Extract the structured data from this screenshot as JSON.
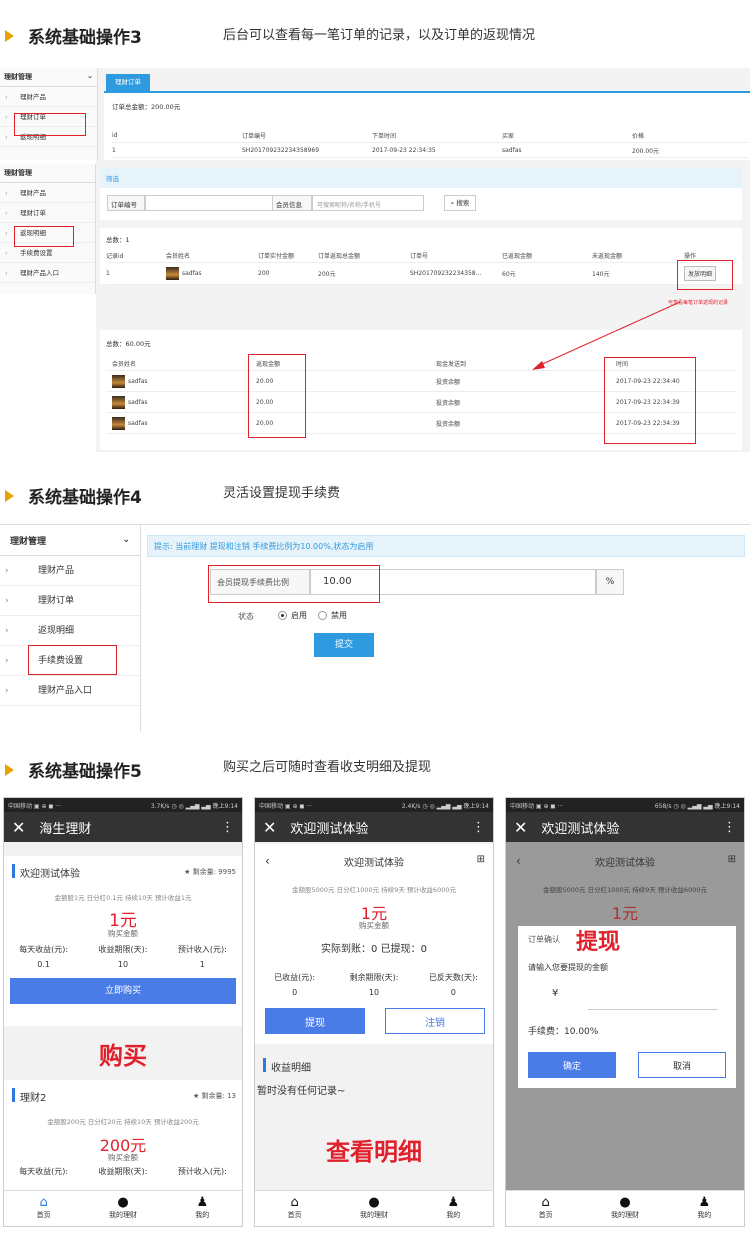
{
  "sec3": {
    "title": "系统基础操作3",
    "desc": "后台可以查看每一笔订单的记录，以及订单的返现情况"
  },
  "sec4": {
    "title": "系统基础操作4",
    "desc": "灵活设置提现手续费"
  },
  "sec5": {
    "title": "系统基础操作5",
    "desc": "购买之后可随时查看收支明细及提现"
  },
  "shot1": {
    "side_header": "理财管理",
    "side_items": [
      "理财产品",
      "理财订单",
      "返现明细"
    ],
    "tab": "理财订单",
    "summary": "订单总金额：200.00元",
    "cols": [
      "id",
      "订单编号",
      "下单时间",
      "买家",
      "价格"
    ],
    "row": [
      "1",
      "SH201709232234358969",
      "2017-09-23 22:34:35",
      "sadfas",
      "200.00元"
    ]
  },
  "shot2": {
    "side_header": "理财管理",
    "side_items": [
      "理财产品",
      "理财订单",
      "返现明细",
      "手续费设置",
      "理财产品入口"
    ],
    "filter_title": "筛选",
    "order_no_label": "订单编号",
    "member_label": "会员信息",
    "member_placeholder": "可搜索昵称/名称/手机号",
    "search_btn": "搜索",
    "total": "总数：1",
    "cols": [
      "记录id",
      "会员姓名",
      "订单实付金额",
      "订单返现总金额",
      "订单号",
      "已返现金额",
      "未返现金额",
      "操作"
    ],
    "row": [
      "1",
      "sadfas",
      "200",
      "200元",
      "SH201709232234358...",
      "60元",
      "140元",
      "发放明细"
    ],
    "note": "可查看每笔订单返现的记录",
    "total2": "总数：60.00元",
    "cols2": [
      "会员姓名",
      "返现金额",
      "现金发送到",
      "时间"
    ],
    "rows2": [
      [
        "sadfas",
        "20.00",
        "投资余额",
        "2017-09-23 22:34:40"
      ],
      [
        "sadfas",
        "20.00",
        "投资余额",
        "2017-09-23 22:34:39"
      ],
      [
        "sadfas",
        "20.00",
        "投资余额",
        "2017-09-23 22:34:39"
      ]
    ]
  },
  "shot3": {
    "side_header": "理财管理",
    "side_items": [
      "理财产品",
      "理财订单",
      "返现明细",
      "手续费设置",
      "理财产品入口"
    ],
    "tip": "提示: 当前理财 提现和注销 手续费比例为10.00%,状态为启用",
    "fee_label": "会员提现手续费比例",
    "fee_value": "10.00",
    "fee_unit": "%",
    "status_label": "状态",
    "status_on": "启用",
    "status_off": "禁用",
    "submit": "提交"
  },
  "phone1": {
    "status_l": "中国移动 ▣ ⊕ ◼ ···",
    "status_r": "3.7K/s ◷ ◎ ▂▄▆ ▃▅ 晚上9:14",
    "title": "海生理财",
    "p1_name": "欢迎测试体验",
    "p1_remain": "剩余量: 9995",
    "p1_sub": "金额股1元 日分红0.1元 持续10天 预计收益1元",
    "p1_price": "1元",
    "p1_price_label": "购买金额",
    "p1_stats_labels": [
      "每天收益(元):",
      "收益期限(天):",
      "预计收入(元):"
    ],
    "p1_stats_values": [
      "0.1",
      "10",
      "1"
    ],
    "buy_btn": "立即购买",
    "big": "购买",
    "p2_name": "理财2",
    "p2_remain": "剩余量: 13",
    "p2_sub": "金额股200元 日分红20元 持续10天 预计收益200元",
    "p2_price": "200元",
    "p2_price_label": "购买金额",
    "p2_stats_labels": [
      "每天收益(元):",
      "收益期限(天):",
      "预计收入(元):"
    ]
  },
  "phone2": {
    "status_l": "中国移动 ▣ ⊕ ◼ ···",
    "status_r": "2.4K/s ◷ ◎ ▂▄▆ ▃▅ 晚上9:14",
    "title": "欢迎测试体验",
    "sub_title": "欢迎测试体验",
    "sub": "金额股5000元 日分红1000元 持续9天 预计收益6000元",
    "price": "1元",
    "price_label": "购买金额",
    "settle": "实际到账：0   已提现：0",
    "stats_labels": [
      "已收益(元):",
      "剩余期限(天):",
      "已反天数(天):"
    ],
    "stats_values": [
      "0",
      "10",
      "0"
    ],
    "withdraw": "提现",
    "cancel": "注销",
    "detail_title": "收益明细",
    "empty": "暂时没有任何记录~",
    "big": "查看明细"
  },
  "phone3": {
    "status_l": "中国移动 ▣ ⊕ ◼ ···",
    "status_r": "658/s ◷ ◎ ▂▄▆ ▃▅ 晚上9:14",
    "title": "欢迎测试体验",
    "sub_title": "欢迎测试体验",
    "sub": "金额股5000元 日分红1000元 持续9天 预计收益6000元",
    "price": "1元",
    "dlg_title": "订单确认",
    "big": "提现",
    "dlg_prompt": "请输入您要提现的金额",
    "currency": "¥",
    "fee": "手续费：10.00%",
    "ok": "确定",
    "cancel": "取消"
  },
  "nav": [
    "首页",
    "我的理财",
    "我的"
  ],
  "colors": {
    "accent_blue": "#2e9ae0",
    "red": "#e0212b",
    "arrow": "#e8a200"
  }
}
